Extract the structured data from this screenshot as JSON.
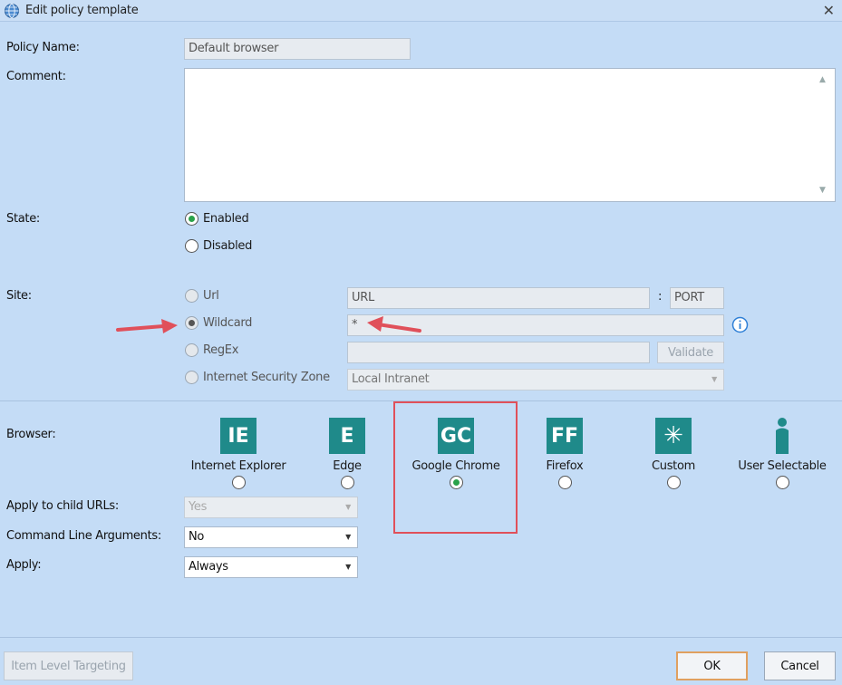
{
  "window": {
    "title": "Edit policy template",
    "close": "✕"
  },
  "policy_name": {
    "label": "Policy Name:",
    "value": "Default browser"
  },
  "comment": {
    "label": "Comment:",
    "value": ""
  },
  "state": {
    "label": "State:",
    "options": [
      {
        "label": "Enabled",
        "checked": true
      },
      {
        "label": "Disabled",
        "checked": false
      }
    ]
  },
  "site": {
    "label": "Site:",
    "options": [
      {
        "label": "Url",
        "checked": false
      },
      {
        "label": "Wildcard",
        "checked": true
      },
      {
        "label": "RegEx",
        "checked": false
      },
      {
        "label": "Internet Security Zone",
        "checked": false
      }
    ],
    "url_placeholder": "URL",
    "port_separator": ":",
    "port_placeholder": "PORT",
    "wildcard_value": "*",
    "regex_value": "",
    "validate_label": "Validate",
    "zone_value": "Local Intranet"
  },
  "browser": {
    "label": "Browser:",
    "options": [
      {
        "abbr": "IE",
        "label": "Internet Explorer",
        "checked": false
      },
      {
        "abbr": "E",
        "label": "Edge",
        "checked": false
      },
      {
        "abbr": "GC",
        "label": "Google Chrome",
        "checked": true
      },
      {
        "abbr": "FF",
        "label": "Firefox",
        "checked": false
      },
      {
        "abbr": "✳",
        "label": "Custom",
        "checked": false
      },
      {
        "abbr": "",
        "label": "User Selectable",
        "checked": false
      }
    ]
  },
  "apply_child_urls": {
    "label": "Apply to child URLs:",
    "value": "Yes"
  },
  "command_line_args": {
    "label": "Command Line Arguments:",
    "value": "No"
  },
  "apply": {
    "label": "Apply:",
    "value": "Always"
  },
  "footer": {
    "item_level_targeting": "Item Level Targeting",
    "ok": "OK",
    "cancel": "Cancel"
  },
  "colors": {
    "accent_red": "#e0505a",
    "icon_teal": "#1f8a8a",
    "radio_green": "#2aa24a",
    "background": "#c4dcf6"
  },
  "icons": {
    "title": "globe-icon",
    "info": "info-icon",
    "arrow": "red-arrow-icon"
  }
}
